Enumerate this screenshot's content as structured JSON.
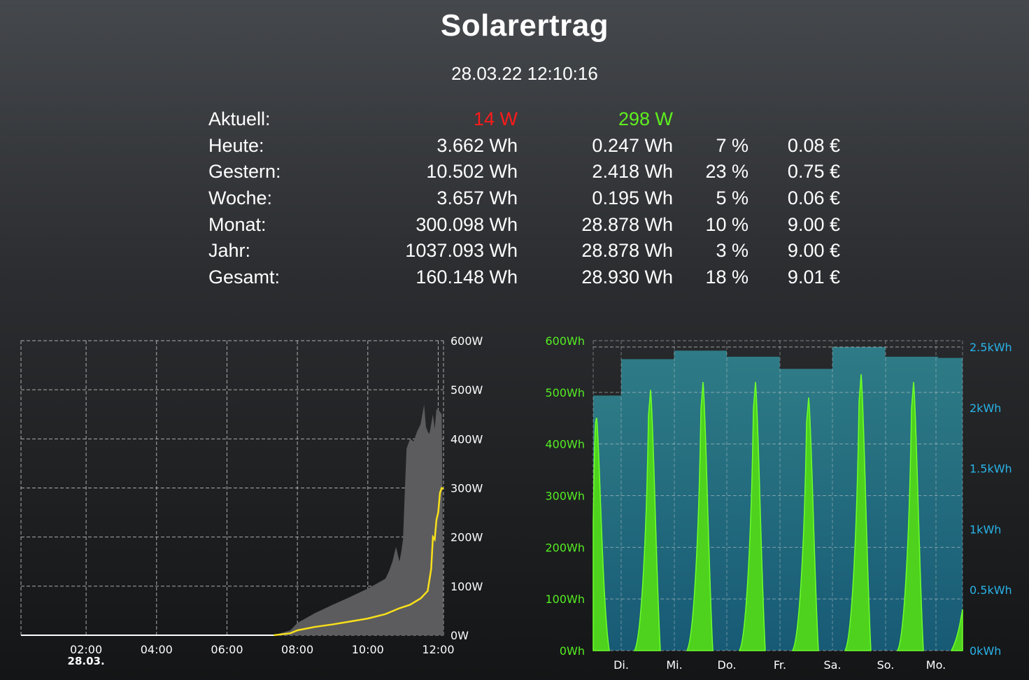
{
  "header": {
    "title": "Solarertrag",
    "datetime": "28.03.22 12:10:16"
  },
  "colors": {
    "consumption": "#ff1a1a",
    "production": "#5ef01e",
    "yellow_line": "#f8e01a",
    "gray_area": "#5c5c5e",
    "teal_bars": "#2b7d89",
    "daily_axis": "#2ab3e8",
    "green_axis": "#55ee22"
  },
  "stats": {
    "current": {
      "label": "Aktuell:",
      "value1": "14 W",
      "value2": "298 W"
    },
    "rows": [
      {
        "label": "Heute:",
        "value1": "3.662 Wh",
        "value2": "0.247 Wh",
        "pct": "7 %",
        "eur": "0.08 €"
      },
      {
        "label": "Gestern:",
        "value1": "10.502 Wh",
        "value2": "2.418 Wh",
        "pct": "23 %",
        "eur": "0.75 €"
      },
      {
        "label": "Woche:",
        "value1": "3.657 Wh",
        "value2": "0.195 Wh",
        "pct": "5 %",
        "eur": "0.06 €"
      },
      {
        "label": "Monat:",
        "value1": "300.098 Wh",
        "value2": "28.878 Wh",
        "pct": "10 %",
        "eur": "9.00 €"
      },
      {
        "label": "Jahr:",
        "value1": "1037.093 Wh",
        "value2": "28.878 Wh",
        "pct": "3 %",
        "eur": "9.00 €"
      },
      {
        "label": "Gesamt:",
        "value1": "160.148 Wh",
        "value2": "28.930 Wh",
        "pct": "18 %",
        "eur": "9.01 €"
      }
    ]
  },
  "chart_data": [
    {
      "type": "area",
      "xlabel": "",
      "ylabel": "",
      "x_ticks": [
        "02:00",
        "04:00",
        "06:00",
        "08:00",
        "10:00",
        "12:00"
      ],
      "x_sublabel": "28.03.",
      "y_ticks": [
        "0W",
        "100W",
        "200W",
        "300W",
        "400W",
        "500W",
        "600W"
      ],
      "ylim": [
        0,
        600
      ],
      "grid": true,
      "series": [
        {
          "x": [
            7.33,
            7.8,
            8.0,
            8.5,
            9.0,
            9.5,
            10.0,
            10.5,
            10.6,
            10.7,
            10.8,
            10.9,
            10.95,
            11.0,
            11.05,
            11.1,
            11.2,
            11.3,
            11.35,
            11.4,
            11.5,
            11.6,
            11.65,
            11.7,
            11.75,
            11.8,
            11.85,
            11.9,
            11.95,
            12.0,
            12.1,
            12.15
          ],
          "values": [
            0,
            10,
            25,
            45,
            62,
            78,
            95,
            115,
            130,
            150,
            180,
            150,
            170,
            195,
            290,
            380,
            400,
            395,
            405,
            415,
            430,
            470,
            425,
            415,
            410,
            430,
            450,
            420,
            460,
            460,
            450,
            0
          ]
        },
        {
          "x": [
            7.33,
            7.8,
            8.0,
            8.5,
            9.0,
            9.5,
            10.0,
            10.5,
            10.9,
            11.2,
            11.5,
            11.7,
            11.8,
            11.85,
            11.9,
            11.95,
            12.0,
            12.05,
            12.1,
            12.15
          ],
          "values": [
            0,
            4,
            10,
            17,
            22,
            28,
            34,
            43,
            55,
            62,
            75,
            90,
            135,
            200,
            195,
            235,
            250,
            290,
            300,
            298
          ]
        }
      ]
    },
    {
      "type": "bar",
      "xlabel": "",
      "ylabel": "",
      "categories": [
        "Di.",
        "Mi.",
        "Do.",
        "Fr.",
        "Sa.",
        "So.",
        "Mo."
      ],
      "y_left_ticks": [
        "0Wh",
        "100Wh",
        "200Wh",
        "300Wh",
        "400Wh",
        "500Wh",
        "600Wh"
      ],
      "y_right_ticks": [
        "0kWh",
        "0.5kWh",
        "1kWh",
        "1.5kWh",
        "2kWh",
        "2.5kWh"
      ],
      "ylim_left": [
        0,
        600
      ],
      "ylim_right": [
        0,
        2.5
      ],
      "grid": true,
      "series": [
        {
          "values": [
            2.1,
            2.4,
            2.47,
            2.42,
            2.32,
            2.5,
            2.42,
            2.41
          ]
        },
        {
          "values": [
            450,
            505,
            520,
            520,
            490,
            535,
            520,
            80
          ]
        }
      ]
    }
  ]
}
